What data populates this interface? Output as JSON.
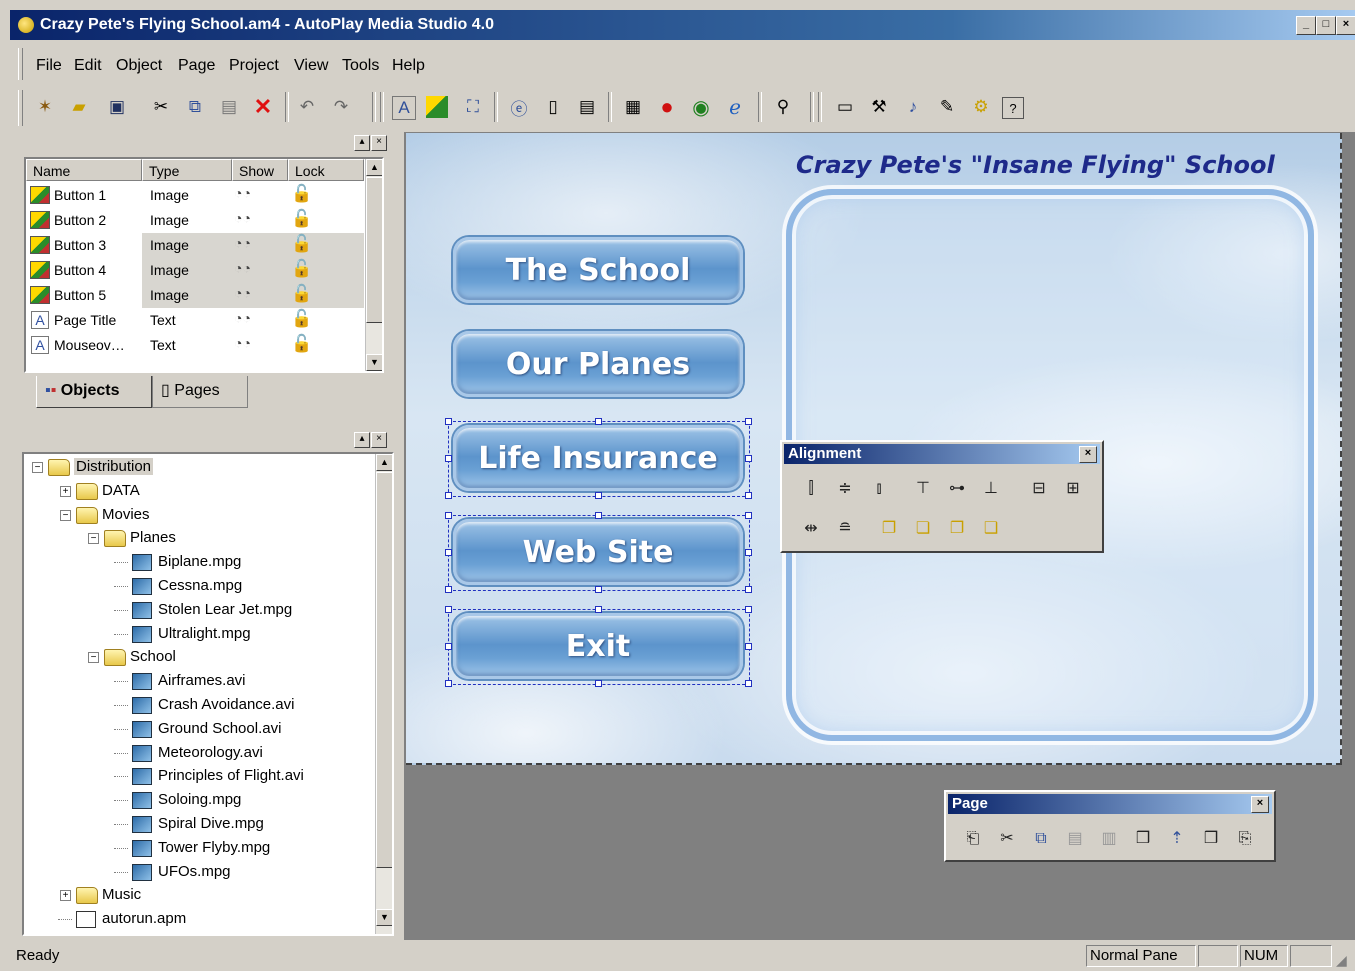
{
  "window": {
    "title": "Crazy Pete's Flying School.am4 - AutoPlay Media Studio 4.0",
    "buttons": {
      "minimize": "_",
      "maximize": "□",
      "close": "×"
    }
  },
  "menu": [
    "File",
    "Edit",
    "Object",
    "Page",
    "Project",
    "View",
    "Tools",
    "Help"
  ],
  "object_panel": {
    "columns": [
      "Name",
      "Type",
      "Show",
      "Lock"
    ],
    "rows": [
      {
        "name": "Button 1",
        "type": "Image",
        "icon": "image-icon"
      },
      {
        "name": "Button 2",
        "type": "Image",
        "icon": "image-icon"
      },
      {
        "name": "Button 3",
        "type": "Image",
        "icon": "image-icon"
      },
      {
        "name": "Button 4",
        "type": "Image",
        "icon": "image-icon"
      },
      {
        "name": "Button 5",
        "type": "Image",
        "icon": "image-icon"
      },
      {
        "name": "Page Title",
        "type": "Text",
        "icon": "text-icon"
      },
      {
        "name": "Mouseov…",
        "type": "Text",
        "icon": "text-icon"
      }
    ],
    "tabs": [
      "Objects",
      "Pages"
    ]
  },
  "file_tree": {
    "root": "Distribution",
    "data": "DATA",
    "movies": "Movies",
    "planes": "Planes",
    "plane_files": [
      "Biplane.mpg",
      "Cessna.mpg",
      "Stolen Lear Jet.mpg",
      "Ultralight.mpg"
    ],
    "school": "School",
    "school_files": [
      "Airframes.avi",
      "Crash Avoidance.avi",
      "Ground School.avi",
      "Meteorology.avi",
      "Principles of Flight.avi",
      "Soloing.mpg",
      "Spiral Dive.mpg",
      "Tower Flyby.mpg",
      "UFOs.mpg"
    ],
    "music": "Music",
    "autorun": "autorun.apm"
  },
  "page": {
    "title": "Crazy Pete's \"Insane Flying\" School",
    "buttons": [
      "The School",
      "Our Planes",
      "Life Insurance",
      "Web Site",
      "Exit"
    ]
  },
  "alignment_toolbar": {
    "title": "Alignment"
  },
  "page_toolbar": {
    "title": "Page"
  },
  "status": {
    "text": "Ready",
    "pane": "Normal Pane",
    "num": "NUM"
  },
  "colors": {
    "titlebar": "#0a246a",
    "page_title": "#1e2a8a",
    "button": "#5c94cc"
  }
}
